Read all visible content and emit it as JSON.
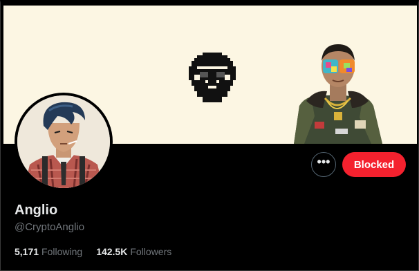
{
  "profile": {
    "display_name": "Anglio",
    "handle": "@CryptoAnglio",
    "avatar_icon": "anime-portrait-avatar",
    "banner_icons": [
      "pixel-face-logo-icon",
      "illustrated-person-icon"
    ]
  },
  "actions": {
    "more_label": "•••",
    "blocked_label": "Blocked"
  },
  "stats": {
    "following_count": "5,171",
    "following_label": "Following",
    "followers_count": "142.5K",
    "followers_label": "Followers"
  },
  "colors": {
    "background": "#000000",
    "banner": "#fcf6e3",
    "blocked_button": "#f4212e",
    "secondary_text": "#71767b",
    "primary_text": "#e7e9ea"
  }
}
